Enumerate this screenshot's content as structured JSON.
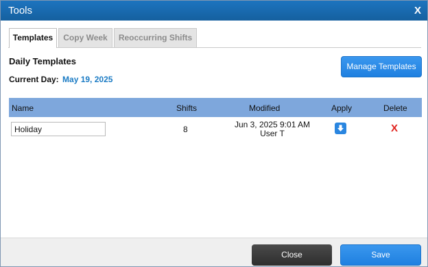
{
  "window": {
    "title": "Tools",
    "close_label": "X"
  },
  "tabs": [
    {
      "label": "Templates",
      "active": true
    },
    {
      "label": "Copy Week",
      "active": false
    },
    {
      "label": "Reoccurring Shifts",
      "active": false
    }
  ],
  "section": {
    "heading": "Daily Templates",
    "current_day_label": "Current Day:",
    "current_day_value": "May 19, 2025",
    "manage_button": "Manage Templates"
  },
  "table": {
    "columns": [
      "Name",
      "Shifts",
      "Modified",
      "Apply",
      "Delete"
    ],
    "rows": [
      {
        "name": "Holiday",
        "shifts": "8",
        "modified_date": "Jun 3, 2025 9:01 AM",
        "modified_by": "User T",
        "apply_icon": "apply-down-arrow-icon",
        "delete_icon": "X"
      }
    ]
  },
  "footer": {
    "close_label": "Close",
    "save_label": "Save"
  },
  "colors": {
    "titlebar": "#1d74bf",
    "accent_blue": "#1f80e0",
    "date_blue": "#1b7bc4",
    "table_header": "#7ea7dc",
    "delete_red": "#e0201b",
    "close_button": "#2e2e2e"
  }
}
